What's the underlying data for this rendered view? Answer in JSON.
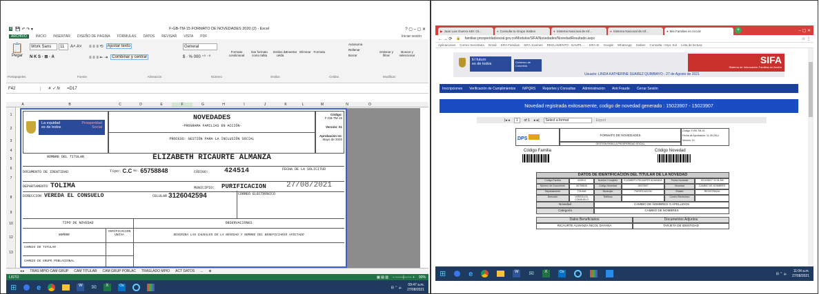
{
  "excel": {
    "title": "F-GB-TM-15 FORMATO DE NOVEDADES 2020 (2) - Excel",
    "win_ctrl": "?  ▢  –  ▢  ✕",
    "signin": "Iniciar sesión",
    "tabs": [
      "ARCHIVO",
      "INICIO",
      "INSERTAR",
      "DISEÑO DE PÁGINA",
      "FÓRMULAS",
      "DATOS",
      "REVISAR",
      "VISTA",
      "PDF"
    ],
    "ribbon": {
      "paste": "Pegar",
      "font_name": "Work Sans",
      "font_size": "11",
      "wrap": "Ajustar texto",
      "merge": "Combinar y centrar",
      "number_format": "General",
      "cond_format": "Formato condicional",
      "table_format": "Dar formato como tabla",
      "cell_styles": "Estilos de celda",
      "insert": "Insertar",
      "delete": "Eliminar",
      "format": "Formato",
      "autosum": "Autosuma",
      "fill": "Rellenar",
      "clear": "Borrar",
      "sort": "Ordenar y filtrar",
      "find": "Buscar y seleccionar",
      "groups": [
        "Portapapeles",
        "Fuente",
        "Alineación",
        "Número",
        "Estilos",
        "Celdas",
        "Modificar"
      ]
    },
    "name_box": "F42",
    "formula": "=D17",
    "columns": [
      "A",
      "B",
      "C",
      "D",
      "E",
      "F",
      "G",
      "H",
      "I",
      "J",
      "K",
      "L",
      "M",
      "N",
      "O"
    ],
    "rows": [
      "1",
      "2",
      "3",
      "4",
      "5",
      "6",
      "7",
      "8",
      "9",
      "10",
      "12",
      "13"
    ],
    "sheet": {
      "logo_line1": "La equidad",
      "logo_line2": "es de todos",
      "logo_line3": "Prosperidad",
      "logo_line4": "Social",
      "heading": "NOVEDADES",
      "program": "-PROGRAMA FAMILIAS EN ACCIÓN-",
      "process": "PROCESO: GESTIÓN PARA LA INCLUSIÓN SOCIAL",
      "code_label": "Código:",
      "code_value": "F-GB-TM-15",
      "version": "Versión: 01",
      "approval": "Aprobación en:",
      "approval_date": "Mayo de 2020",
      "holder_label": "NOMBRE DEL TITULAR",
      "holder_name": "ELIZABETH RICAURTE ALMANZA",
      "id_label": "DOCUMENTO DE IDENTIDAD",
      "tipo_label": "Tipo:",
      "tipo_value": "C.C",
      "no_label": "No.",
      "id_number": "65758848",
      "codigo_label": "CÓDIGO:",
      "codigo_value": "424514",
      "request_date_label": "FECHA DE LA SOLICITUD",
      "request_date": "27/08/2021",
      "dept_label": "DEPARTAMENTO",
      "dept_value": "TOLIMA",
      "muni_label": "MUNICIPIO:",
      "muni_value": "PURIFICACION",
      "addr_label": "DIRECCION",
      "addr_value": "VEREDA EL CONSUELO",
      "cel_label": "CELULAR",
      "cel_value": "3126042594",
      "email_label": "CORREO ELECTRÓNICO",
      "type_header": "TIPO DE NOVEDAD",
      "obs_header": "OBSERVACIONES",
      "nombre_col": "NOMBRE",
      "verif_col": "VERIFICACION UNIVA",
      "obs_desc": "DESCRIBA LAS CAUSALES DE LA NOVEDAD Y NOMBRE DEL BENEFICIARIO AFECTADO",
      "row_cambio_titular": "CAMBIO DE TITULAR",
      "row_cambio_grupo": "CAMBIO DE GRUPO POBLACIONAL"
    },
    "sheet_tabs": [
      "TRAS MPIO CAM GRUP",
      "CAM TITULAR",
      "CAM GRUP POBLAC",
      "TRASLADO MPIO",
      "ACT DATOS",
      "...",
      "⊕"
    ],
    "status": "LISTO",
    "zoom": "90%",
    "clock_time": "09:47 a.m.",
    "clock_date": "27/08/2021"
  },
  "browser": {
    "tabs": [
      "Juan Luis Guerra 440: Ot...",
      "Consulta tu Grupo Sisben",
      "Sistema Nacional de Inf...",
      "Sistema Nacional de Inf...",
      "Mis Familias en Acción"
    ],
    "url": "familias.prosperidadsocial.gov.co/Modulos/SIFA/Novedades/NovedadResultado.aspx",
    "bookmarks": [
      "Aplicaciones",
      "Correo Secretaria",
      "Gmail",
      "SIFA Familias",
      "SIFA Jovenes",
      "REGLAMENTO - DAVIPL...",
      "SIFA SI",
      "Google",
      "WhatsApp",
      "Sisben",
      "Consulta - Impr. Sol",
      "Lista de lectura"
    ],
    "header_logo1": "El futuro",
    "header_logo2": "es de todos",
    "header_gov": "Gobierno de Colombia",
    "sifa": "SIFA",
    "sifa_sub": "Sistema de Información Familias en Acción",
    "user_line": "Usuario: LINDA KATHERINE SUAREZ QUIMBAYO - 27 de Agosto de 2021",
    "nav": [
      "Inscripciones",
      "Verificación de Cumplimientos",
      "N/PQRS",
      "Reportes y Consultas",
      "Administración",
      "Anti Fraude",
      "Cerrar Sesión"
    ],
    "banner": "Novedad registrada exitosamente, codigo de novedad generado : 15023907 - 15023907",
    "report_page": "1",
    "report_of": "of 1",
    "report_format": "Select a format",
    "report_export": "Export",
    "report_title": "FORMATO DE NOVEDADES",
    "report_sub": "GESTIÓN PARA LA PROSPERIDAD SOCIAL",
    "report_code": "Código: F-BS-TM-15",
    "report_approval": "Fecha de Aprobación: 11-09-2014",
    "report_version": "Versión: 10",
    "barcode_family": "Código Familia",
    "barcode_novelty": "Código Novedad",
    "section_title": "DATOS DE IDENTIFICACIÓN DEL TITULAR DE LA NOVEDAD",
    "grid": [
      [
        "Código Familia",
        "424514",
        "Nombre Completo",
        "ELIZABETH RICAURTE ALMANZA",
        "Fecha Novedad",
        "2021/08/27 11:04 AM"
      ],
      [
        "Número de Documento",
        "65758848",
        "Código Novedad",
        "15023907",
        "Novedad",
        "CAMBIO DE NOMBRES"
      ],
      [
        "Departamento",
        "TOLIMA",
        "Municipio",
        "PURIFICACION",
        "Estado",
        "REGISTRADA"
      ],
      [
        "Dirección",
        "VEREDA EL CONSUELO",
        "Teléfono",
        "",
        "Correo Electrónico",
        ""
      ]
    ],
    "novedad_label": "Novedad",
    "novedad_value": "CAMBIO DE NOMBRES O APELLIDOS",
    "categoria_label": "Categoría",
    "categoria_value": "CAMBIO DE NOMBRES",
    "datos_benef": "Datos Beneficiarios",
    "docs_adj": "Documentos Adjuntos",
    "benef_name": "RICAURTE ALMANZA NICOL DAYANA",
    "doc_type": "TARJETA DE IDENTIDAD",
    "clock_time": "11:04 a.m.",
    "clock_date": "27/08/2021"
  },
  "colors": {
    "excel_green": "#217346",
    "sifa_blue": "#1a3f9c",
    "chrome_red": "#d7403a",
    "taskbar": "#1e3a5f"
  }
}
